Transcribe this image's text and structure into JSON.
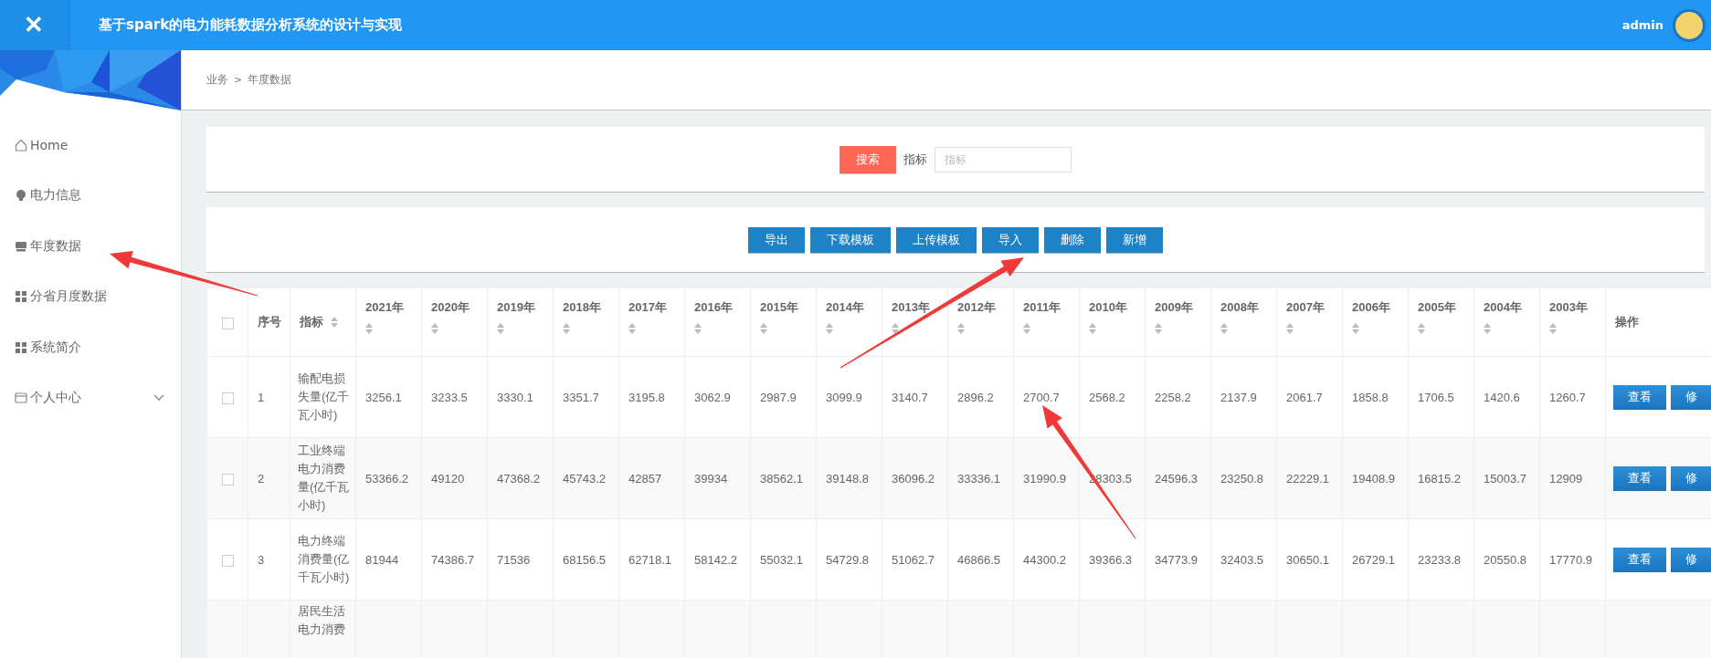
{
  "header": {
    "close_glyph": "✕",
    "title": "基于spark的电力能耗数据分析系统的设计与实现",
    "user": "admin"
  },
  "sidebar": {
    "items": [
      {
        "label": "Home"
      },
      {
        "label": "电力信息"
      },
      {
        "label": "年度数据"
      },
      {
        "label": "分省月度数据"
      },
      {
        "label": "系统简介"
      },
      {
        "label": "个人中心",
        "expanded": false
      }
    ]
  },
  "breadcrumb": {
    "items": [
      "业务",
      "年度数据"
    ],
    "separator": ">"
  },
  "search": {
    "button": "搜索",
    "label": "指标",
    "placeholder": "指标"
  },
  "toolbar": {
    "buttons": [
      "导出",
      "下载模板",
      "上传模板",
      "导入",
      "删除",
      "新增"
    ]
  },
  "table": {
    "select_all": {
      "checked": false
    },
    "columns": [
      {
        "label": "序号",
        "kind": "plain"
      },
      {
        "label": "指标",
        "kind": "sort-inline"
      },
      {
        "label": "2021年",
        "kind": "sort-stacked"
      },
      {
        "label": "2020年",
        "kind": "sort-stacked"
      },
      {
        "label": "2019年",
        "kind": "sort-stacked"
      },
      {
        "label": "2018年",
        "kind": "sort-stacked"
      },
      {
        "label": "2017年",
        "kind": "sort-stacked"
      },
      {
        "label": "2016年",
        "kind": "sort-stacked"
      },
      {
        "label": "2015年",
        "kind": "sort-stacked"
      },
      {
        "label": "2014年",
        "kind": "sort-stacked"
      },
      {
        "label": "2013年",
        "kind": "sort-stacked"
      },
      {
        "label": "2012年",
        "kind": "sort-stacked"
      },
      {
        "label": "2011年",
        "kind": "sort-stacked"
      },
      {
        "label": "2010年",
        "kind": "sort-stacked"
      },
      {
        "label": "2009年",
        "kind": "sort-stacked"
      },
      {
        "label": "2008年",
        "kind": "sort-stacked"
      },
      {
        "label": "2007年",
        "kind": "sort-stacked"
      },
      {
        "label": "2006年",
        "kind": "sort-stacked"
      },
      {
        "label": "2005年",
        "kind": "sort-stacked"
      },
      {
        "label": "2004年",
        "kind": "sort-stacked"
      },
      {
        "label": "2003年",
        "kind": "sort-stacked"
      },
      {
        "label": "操作",
        "kind": "plain"
      }
    ],
    "rows": [
      {
        "checked": false,
        "cells": [
          "1",
          "输配电损失量(亿千瓦小时)",
          "3256.1",
          "3233.5",
          "3330.1",
          "3351.7",
          "3195.8",
          "3062.9",
          "2987.9",
          "3099.9",
          "3140.7",
          "2896.2",
          "2700.7",
          "2568.2",
          "2258.2",
          "2137.9",
          "2061.7",
          "1858.8",
          "1706.5",
          "1420.6",
          "1260.7"
        ],
        "actions": [
          "查看",
          "修"
        ]
      },
      {
        "checked": false,
        "cells": [
          "2",
          "工业终端电力消费量(亿千瓦小时)",
          "53366.2",
          "49120",
          "47368.2",
          "45743.2",
          "42857",
          "39934",
          "38562.1",
          "39148.8",
          "36096.2",
          "33336.1",
          "31990.9",
          "28303.5",
          "24596.3",
          "23250.8",
          "22229.1",
          "19408.9",
          "16815.2",
          "15003.7",
          "12909"
        ],
        "actions": [
          "查看",
          "修"
        ]
      },
      {
        "checked": false,
        "cells": [
          "3",
          "电力终端消费量(亿千瓦小时)",
          "81944",
          "74386.7",
          "71536",
          "68156.5",
          "62718.1",
          "58142.2",
          "55032.1",
          "54729.8",
          "51062.7",
          "46866.5",
          "44300.2",
          "39366.3",
          "34773.9",
          "32403.5",
          "30650.1",
          "26729.1",
          "23233.8",
          "20550.8",
          "17770.9"
        ],
        "actions": [
          "查看",
          "修"
        ]
      },
      {
        "cells": [
          "",
          "居民生活电力消费"
        ]
      }
    ]
  }
}
